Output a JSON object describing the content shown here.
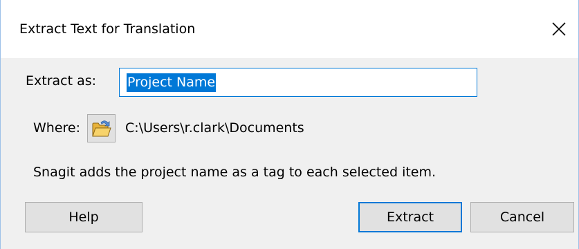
{
  "dialog": {
    "title": "Extract Text for Translation",
    "close_icon": "close-icon"
  },
  "form": {
    "extract_as_label": "Extract as:",
    "extract_as_value": "Project Name",
    "where_label": "Where:",
    "folder_icon": "folder-icon",
    "where_path": "C:\\Users\\r.clark\\Documents",
    "info_text": "Snagit adds the project name as a tag to each selected item."
  },
  "buttons": {
    "help_label": "Help",
    "extract_label": "Extract",
    "cancel_label": "Cancel"
  },
  "colors": {
    "accent": "#0078d7",
    "dialog_background": "#f0f0f0",
    "button_background": "#e1e1e1"
  }
}
